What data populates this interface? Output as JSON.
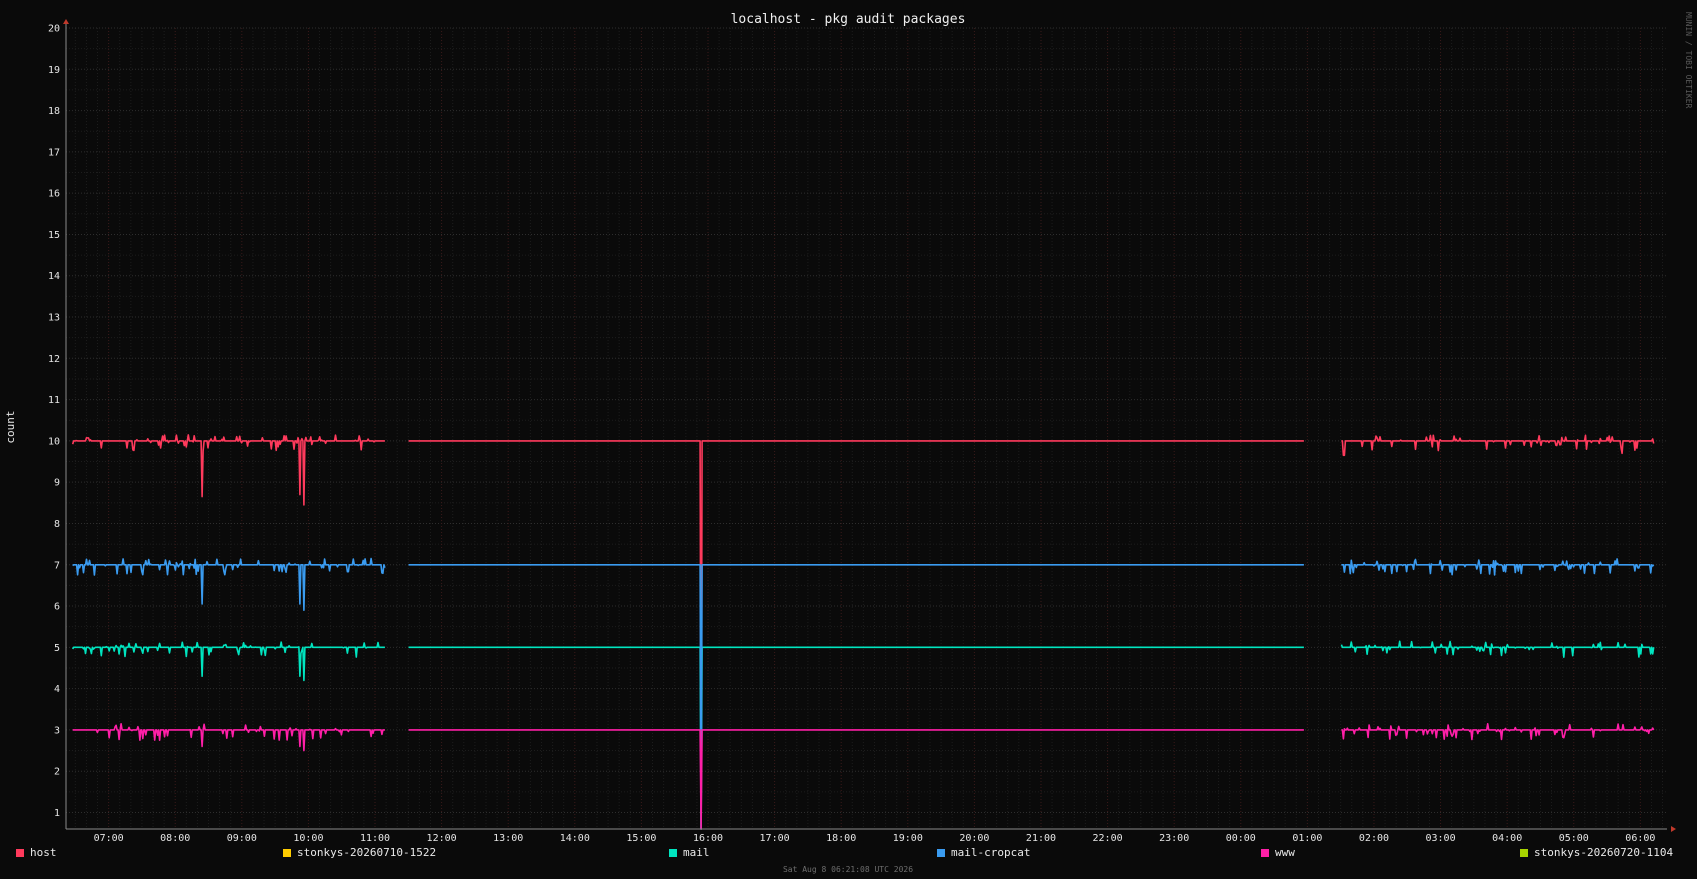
{
  "chart_data": {
    "type": "line",
    "title": "localhost - pkg audit packages",
    "ylabel": "count",
    "ylim": [
      0.6,
      20
    ],
    "yticks": [
      1,
      2,
      3,
      4,
      5,
      6,
      7,
      8,
      9,
      10,
      11,
      12,
      13,
      14,
      15,
      16,
      17,
      18,
      19,
      20
    ],
    "x_ticks": [
      "07:00",
      "08:00",
      "09:00",
      "10:00",
      "11:00",
      "12:00",
      "13:00",
      "14:00",
      "15:00",
      "16:00",
      "17:00",
      "18:00",
      "19:00",
      "20:00",
      "21:00",
      "22:00",
      "23:00",
      "00:00",
      "01:00",
      "02:00",
      "03:00",
      "04:00",
      "05:00",
      "06:00"
    ],
    "x_range_hours": [
      -0.64,
      23.4
    ],
    "grid": true,
    "watermark": "MUNIN / TOBI OETIKER",
    "footer": "Sat Aug  8 06:21:08 UTC 2026",
    "series": [
      {
        "name": "host",
        "color": "#ff3a5c",
        "baseline": 10,
        "dips": [
          [
            1.4,
            8.65
          ],
          [
            2.87,
            8.7
          ],
          [
            2.93,
            8.45
          ],
          [
            8.9,
            0.6
          ],
          [
            18.55,
            9.65
          ],
          [
            22.73,
            9.7
          ]
        ],
        "gaps": [
          [
            4.15,
            4.5
          ],
          [
            17.95,
            18.5
          ]
        ]
      },
      {
        "name": "stonkys-20260710-1522",
        "color": "#ffcc00",
        "baseline": null
      },
      {
        "name": "mail",
        "color": "#00e5c0",
        "baseline": 5,
        "dips": [
          [
            1.4,
            4.3
          ],
          [
            2.87,
            4.3
          ],
          [
            2.93,
            4.2
          ],
          [
            8.9,
            0.6
          ]
        ],
        "gaps": [
          [
            4.15,
            4.5
          ],
          [
            17.95,
            18.5
          ]
        ]
      },
      {
        "name": "mail-cropcat",
        "color": "#3a9bf0",
        "baseline": 7,
        "dips": [
          [
            1.4,
            6.05
          ],
          [
            2.87,
            6.05
          ],
          [
            2.93,
            5.9
          ],
          [
            8.9,
            0.6
          ]
        ],
        "gaps": [
          [
            4.15,
            4.5
          ],
          [
            17.95,
            18.5
          ]
        ]
      },
      {
        "name": "www",
        "color": "#ff1fa8",
        "baseline": 3,
        "dips": [
          [
            1.4,
            2.6
          ],
          [
            2.87,
            2.6
          ],
          [
            2.93,
            2.5
          ],
          [
            8.9,
            0.6
          ]
        ],
        "gaps": [
          [
            4.15,
            4.5
          ],
          [
            17.95,
            18.5
          ]
        ]
      },
      {
        "name": "stonkys-20260720-1104",
        "color": "#a8d400",
        "baseline": null
      }
    ]
  }
}
